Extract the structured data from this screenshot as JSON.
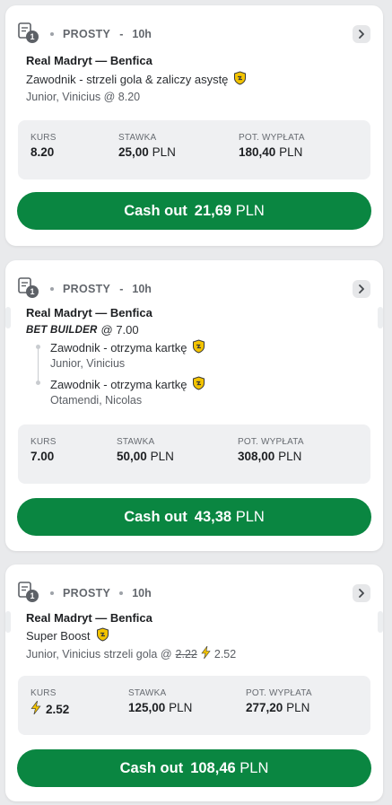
{
  "cards": [
    {
      "type_label": "PROSTY",
      "time": "10h",
      "bet_count": "1",
      "match": "Real Madryt — Benfica",
      "selection": "Zawodnik - strzeli gola & zaliczy asystę",
      "player_odds": "Junior, Vinicius @ 8.20",
      "kurs_label": "KURS",
      "kurs_value": "8.20",
      "stawka_label": "STAWKA",
      "stawka_value": "25,00",
      "stawka_currency": "PLN",
      "payout_label": "POT. WYPŁATA",
      "payout_value": "180,40",
      "payout_currency": "PLN",
      "cashout_label": "Cash out",
      "cashout_amount": "21,69",
      "cashout_currency": "PLN"
    },
    {
      "type_label": "PROSTY",
      "time": "10h",
      "bet_count": "1",
      "match": "Real Madryt — Benfica",
      "bet_builder_tag": "BET BUILDER",
      "bet_builder_odds": "@ 7.00",
      "legs": [
        {
          "selection": "Zawodnik - otrzyma kartkę",
          "player": "Junior, Vinicius"
        },
        {
          "selection": "Zawodnik - otrzyma kartkę",
          "player": "Otamendi, Nicolas"
        }
      ],
      "kurs_label": "KURS",
      "kurs_value": "7.00",
      "stawka_label": "STAWKA",
      "stawka_value": "50,00",
      "stawka_currency": "PLN",
      "payout_label": "POT. WYPŁATA",
      "payout_value": "308,00",
      "payout_currency": "PLN",
      "cashout_label": "Cash out",
      "cashout_amount": "43,38",
      "cashout_currency": "PLN"
    },
    {
      "type_label": "PROSTY",
      "time": "10h",
      "bet_count": "1",
      "match": "Real Madryt — Benfica",
      "selection": "Super Boost",
      "player_text": "Junior, Vinicius strzeli gola @",
      "old_odds": "2.22",
      "new_odds": "2.52",
      "kurs_label": "KURS",
      "kurs_value": "2.52",
      "stawka_label": "STAWKA",
      "stawka_value": "125,00",
      "stawka_currency": "PLN",
      "payout_label": "POT. WYPŁATA",
      "payout_value": "277,20",
      "payout_currency": "PLN",
      "cashout_label": "Cash out",
      "cashout_amount": "108,46",
      "cashout_currency": "PLN"
    }
  ],
  "colors": {
    "cashout_green": "#0a8641",
    "boost_yellow": "#f4c400",
    "background": "#e9eaec"
  },
  "icons": {
    "ticket": "ticket-icon",
    "shield": "boost-shield-icon",
    "lightning": "lightning-icon",
    "chevron": "chevron-right-icon"
  }
}
